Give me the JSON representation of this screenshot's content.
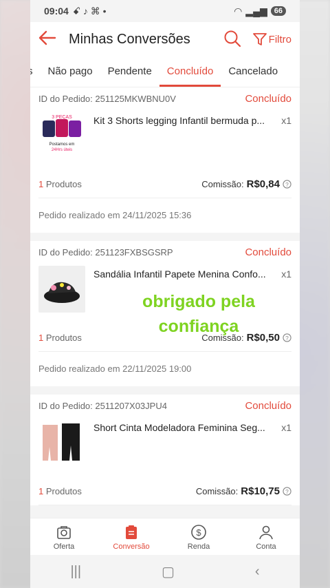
{
  "status_bar": {
    "time": "09:04",
    "battery": "66"
  },
  "header": {
    "title": "Minhas Conversões",
    "filter_label": "Filtro"
  },
  "tabs": [
    {
      "label": "s"
    },
    {
      "label": "Não pago"
    },
    {
      "label": "Pendente"
    },
    {
      "label": "Concluído"
    },
    {
      "label": "Cancelado"
    }
  ],
  "orders": [
    {
      "id": "ID do Pedido: 251125MKWBNU0V",
      "status": "Concluído",
      "product": "Kit 3 Shorts legging Infantil bermuda p...",
      "qty": "x1",
      "count_num": "1",
      "count_label": "Produtos",
      "commission_label": "Comissão:",
      "commission_value": "R$0,84",
      "date": "Pedido realizado em 24/11/2025 15:36"
    },
    {
      "id": "ID do Pedido: 251123FXBSGSRP",
      "status": "Concluído",
      "product": "Sandália Infantil Papete Menina Confo...",
      "qty": "x1",
      "count_num": "1",
      "count_label": "Produtos",
      "commission_label": "Comissão:",
      "commission_value": "R$0,50",
      "date": "Pedido realizado em 22/11/2025 19:00"
    },
    {
      "id": "ID do Pedido: 2511207X03JPU4",
      "status": "Concluído",
      "product": "Short Cinta Modeladora Feminina Seg...",
      "qty": "x1",
      "count_num": "1",
      "count_label": "Produtos",
      "commission_label": "Comissão:",
      "commission_value": "R$10,75",
      "date": ""
    }
  ],
  "overlay_text": {
    "line1": "obrigado pela",
    "line2": "confiança"
  },
  "bottom_nav": [
    {
      "label": "Oferta",
      "icon": "camera-bag-icon"
    },
    {
      "label": "Conversão",
      "icon": "clipboard-icon"
    },
    {
      "label": "Renda",
      "icon": "dollar-circle-icon"
    },
    {
      "label": "Conta",
      "icon": "person-icon"
    }
  ],
  "colors": {
    "accent": "#e24a3b",
    "overlay": "#7ed321"
  }
}
